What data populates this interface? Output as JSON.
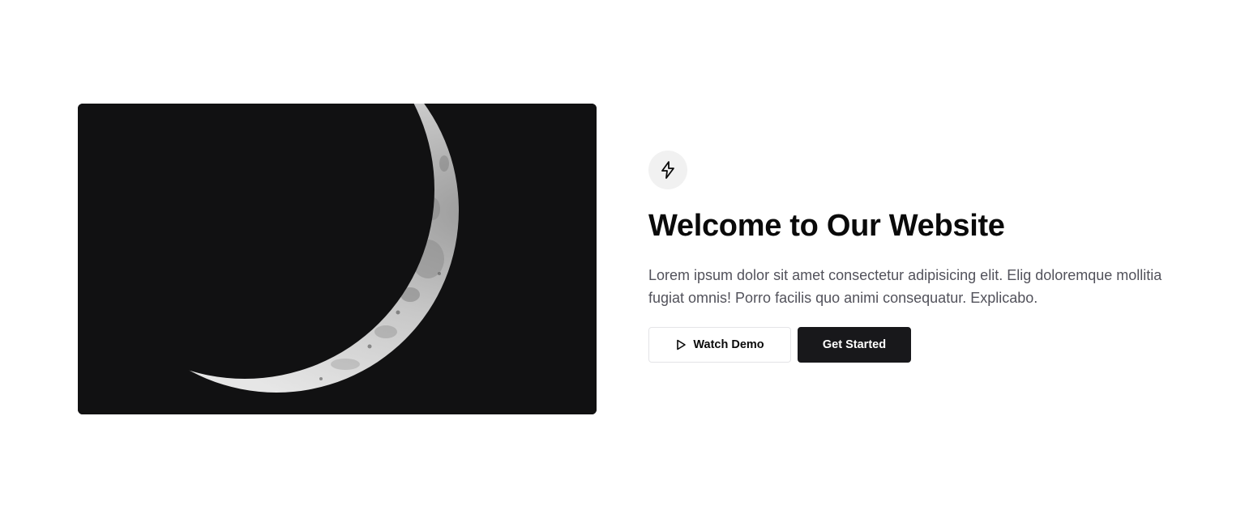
{
  "hero": {
    "image": {
      "subject": "crescent-moon",
      "background_color": "#111112"
    },
    "badge_icon": "lightning-bolt-icon",
    "title": "Welcome to Our Website",
    "description": "Lorem ipsum dolor sit amet consectetur adipisicing elit. Elig doloremque mollitia fugiat omnis! Porro facilis quo animi consequatur. Explicabo.",
    "buttons": {
      "watch_demo": {
        "label": "Watch Demo",
        "icon": "play-icon"
      },
      "get_started": {
        "label": "Get Started"
      }
    }
  },
  "colors": {
    "primary": "#18181b",
    "text": "#0a0a0a",
    "muted_text": "#52525b",
    "badge_bg": "#f1f1f1",
    "border": "#e4e4e7"
  }
}
